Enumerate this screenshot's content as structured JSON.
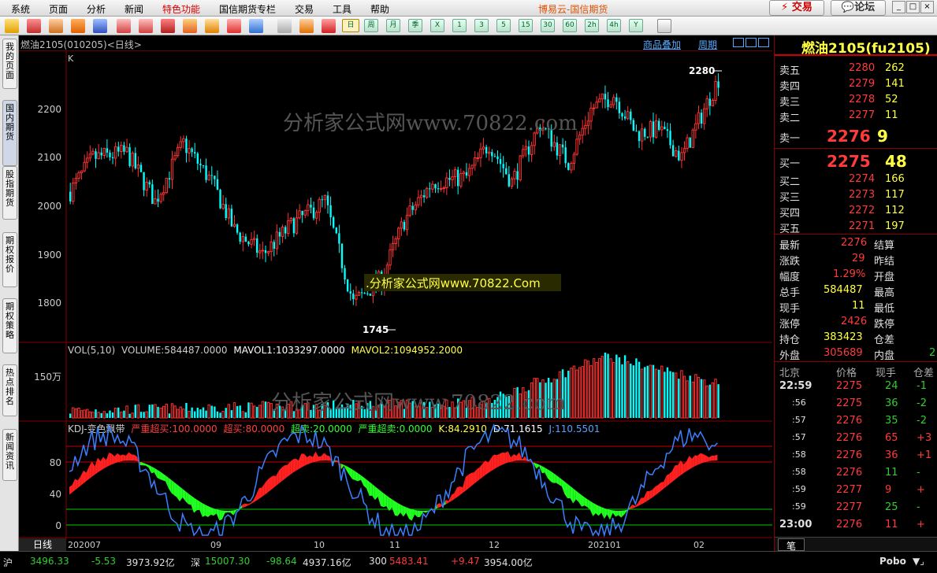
{
  "menu": {
    "items": [
      "系统",
      "页面",
      "分析",
      "新闻",
      "特色功能",
      "国信期货专栏",
      "交易",
      "工具",
      "帮助"
    ],
    "brand": "博易云-国信期货",
    "trade_btn": "交易",
    "forum_btn": "论坛"
  },
  "toolbar": {
    "periods": [
      "日",
      "周",
      "月",
      "季",
      "X",
      "1",
      "3",
      "5",
      "15",
      "30",
      "60",
      "2h",
      "4h",
      "Y"
    ]
  },
  "sidebar": {
    "tabs": [
      "我的页面",
      "国内期货",
      "股指期货",
      "期权报价",
      "期权策略",
      "热点排名",
      "新闻资讯"
    ]
  },
  "chart": {
    "title": "燃油2105(010205)<日线>",
    "links": [
      "商品叠加",
      "周期"
    ],
    "k_label": "K",
    "watermark": "分析家公式网www.70822.com",
    "watermark2": ".分析家公式网www.70822.Com",
    "price_ticks": [
      "2200",
      "2100",
      "2000",
      "1900",
      "1800"
    ],
    "high_label": "2280",
    "low_label": "1745",
    "vol_header": {
      "title": "VOL(5,10)",
      "volume": "VOLUME:584487.0000",
      "ma1": "MAVOL1:1033297.0000",
      "ma2": "MAVOL2:1094952.2000"
    },
    "vol_tick": "150万",
    "kdj_header": {
      "title": "KDJ-变色飘带",
      "p1": "严重超买:100.0000",
      "p2": "超买:80.0000",
      "p3": "超卖:20.0000",
      "p4": "严重超卖:0.0000",
      "k": "K:84.2910",
      "d": "D:71.1615",
      "j": "J:110.5501"
    },
    "kdj_ticks": [
      "80",
      "40",
      "0"
    ],
    "x_axis": [
      "日线",
      "202007",
      "09",
      "10",
      "11",
      "12",
      "202101",
      "02"
    ]
  },
  "quote": {
    "title": "燃油2105(fu2105)",
    "asks": [
      {
        "label": "卖五",
        "price": "2280",
        "vol": "262"
      },
      {
        "label": "卖四",
        "price": "2279",
        "vol": "141"
      },
      {
        "label": "卖三",
        "price": "2278",
        "vol": "52"
      },
      {
        "label": "卖二",
        "price": "2277",
        "vol": "11"
      },
      {
        "label": "卖一",
        "price": "2276",
        "vol": "9"
      }
    ],
    "bids": [
      {
        "label": "买一",
        "price": "2275",
        "vol": "48"
      },
      {
        "label": "买二",
        "price": "2274",
        "vol": "166"
      },
      {
        "label": "买三",
        "price": "2273",
        "vol": "117"
      },
      {
        "label": "买四",
        "price": "2272",
        "vol": "112"
      },
      {
        "label": "买五",
        "price": "2271",
        "vol": "197"
      }
    ],
    "stats": [
      {
        "l1": "最新",
        "v1": "2276",
        "l2": "结算",
        "v2": ""
      },
      {
        "l1": "涨跌",
        "v1": "29",
        "l2": "昨结",
        "v2": ""
      },
      {
        "l1": "幅度",
        "v1": "1.29%",
        "l2": "开盘",
        "v2": ""
      },
      {
        "l1": "总手",
        "v1": "584487",
        "l2": "最高",
        "v2": ""
      },
      {
        "l1": "现手",
        "v1": "11",
        "l2": "最低",
        "v2": ""
      },
      {
        "l1": "涨停",
        "v1": "2426",
        "l2": "跌停",
        "v2": ""
      },
      {
        "l1": "持仓",
        "v1": "383423",
        "l2": "仓差",
        "v2": ""
      },
      {
        "l1": "外盘",
        "v1": "305689",
        "l2": "内盘",
        "v2": "2"
      }
    ],
    "ticks_header": [
      "北京",
      "价格",
      "现手",
      "仓差"
    ],
    "ticks": [
      {
        "t": "22:59",
        "p": "2275",
        "v": "24",
        "d": "-1"
      },
      {
        "t": ":56",
        "p": "2275",
        "v": "36",
        "d": "-2"
      },
      {
        "t": ":57",
        "p": "2276",
        "v": "35",
        "d": "-2"
      },
      {
        "t": ":57",
        "p": "2276",
        "v": "65",
        "d": "+3"
      },
      {
        "t": ":58",
        "p": "2276",
        "v": "36",
        "d": "+1"
      },
      {
        "t": ":58",
        "p": "2276",
        "v": "11",
        "d": "-"
      },
      {
        "t": ":59",
        "p": "2277",
        "v": "9",
        "d": "+"
      },
      {
        "t": ":59",
        "p": "2277",
        "v": "25",
        "d": "-"
      },
      {
        "t": "23:00",
        "p": "2276",
        "v": "11",
        "d": "+"
      }
    ],
    "tab": "笔"
  },
  "status": {
    "sh_label": "沪",
    "sh_idx": "3496.33",
    "sh_chg": "-5.53",
    "sh_amt": "3973.92亿",
    "sz_label": "深",
    "sz_idx": "15007.30",
    "sz_chg": "-98.64",
    "sz_amt": "4937.16亿",
    "c300_label": "300",
    "c300_idx": "5483.41",
    "c300_chg": "+9.47",
    "c300_amt": "3954.00亿",
    "pobo": "Pobo"
  }
}
